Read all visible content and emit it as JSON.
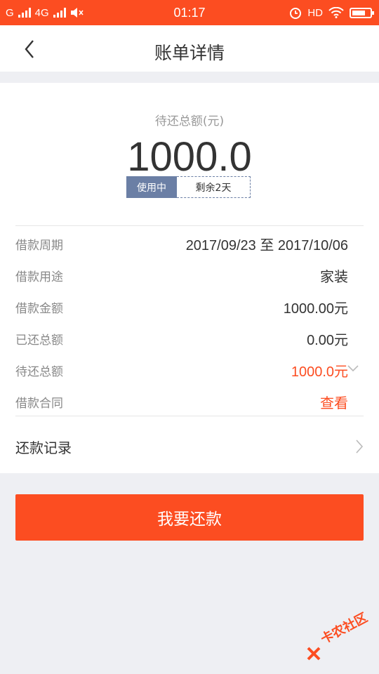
{
  "status_bar": {
    "carrier_1": "G",
    "carrier_2": "4G",
    "time": "01:17",
    "hd": "HD",
    "icons": [
      "signal-icon",
      "mute-icon",
      "alarm-icon",
      "wifi-icon",
      "battery-icon"
    ]
  },
  "header": {
    "title": "账单详情",
    "back_icon": "chevron-left-icon"
  },
  "summary": {
    "label": "待还总额(元)",
    "amount": "1000.0",
    "status_tag": "使用中",
    "remaining_tag": "剩余2天",
    "tag_color": "#6b7fa5"
  },
  "details": {
    "rows": [
      {
        "label": "借款周期",
        "value": "2017/09/23 至 2017/10/06"
      },
      {
        "label": "借款用途",
        "value": "家装"
      },
      {
        "label": "借款金额",
        "value": "1000.00元"
      },
      {
        "label": "已还总额",
        "value": "0.00元"
      },
      {
        "label": "待还总额",
        "value": "1000.0元"
      },
      {
        "label": "借款合同",
        "value": "查看"
      }
    ]
  },
  "record": {
    "label": "还款记录"
  },
  "pay_button": {
    "label": "我要还款"
  },
  "watermark": {
    "text": "卡农社区"
  },
  "colors": {
    "accent": "#fc4d21",
    "background": "#eeeff3"
  }
}
